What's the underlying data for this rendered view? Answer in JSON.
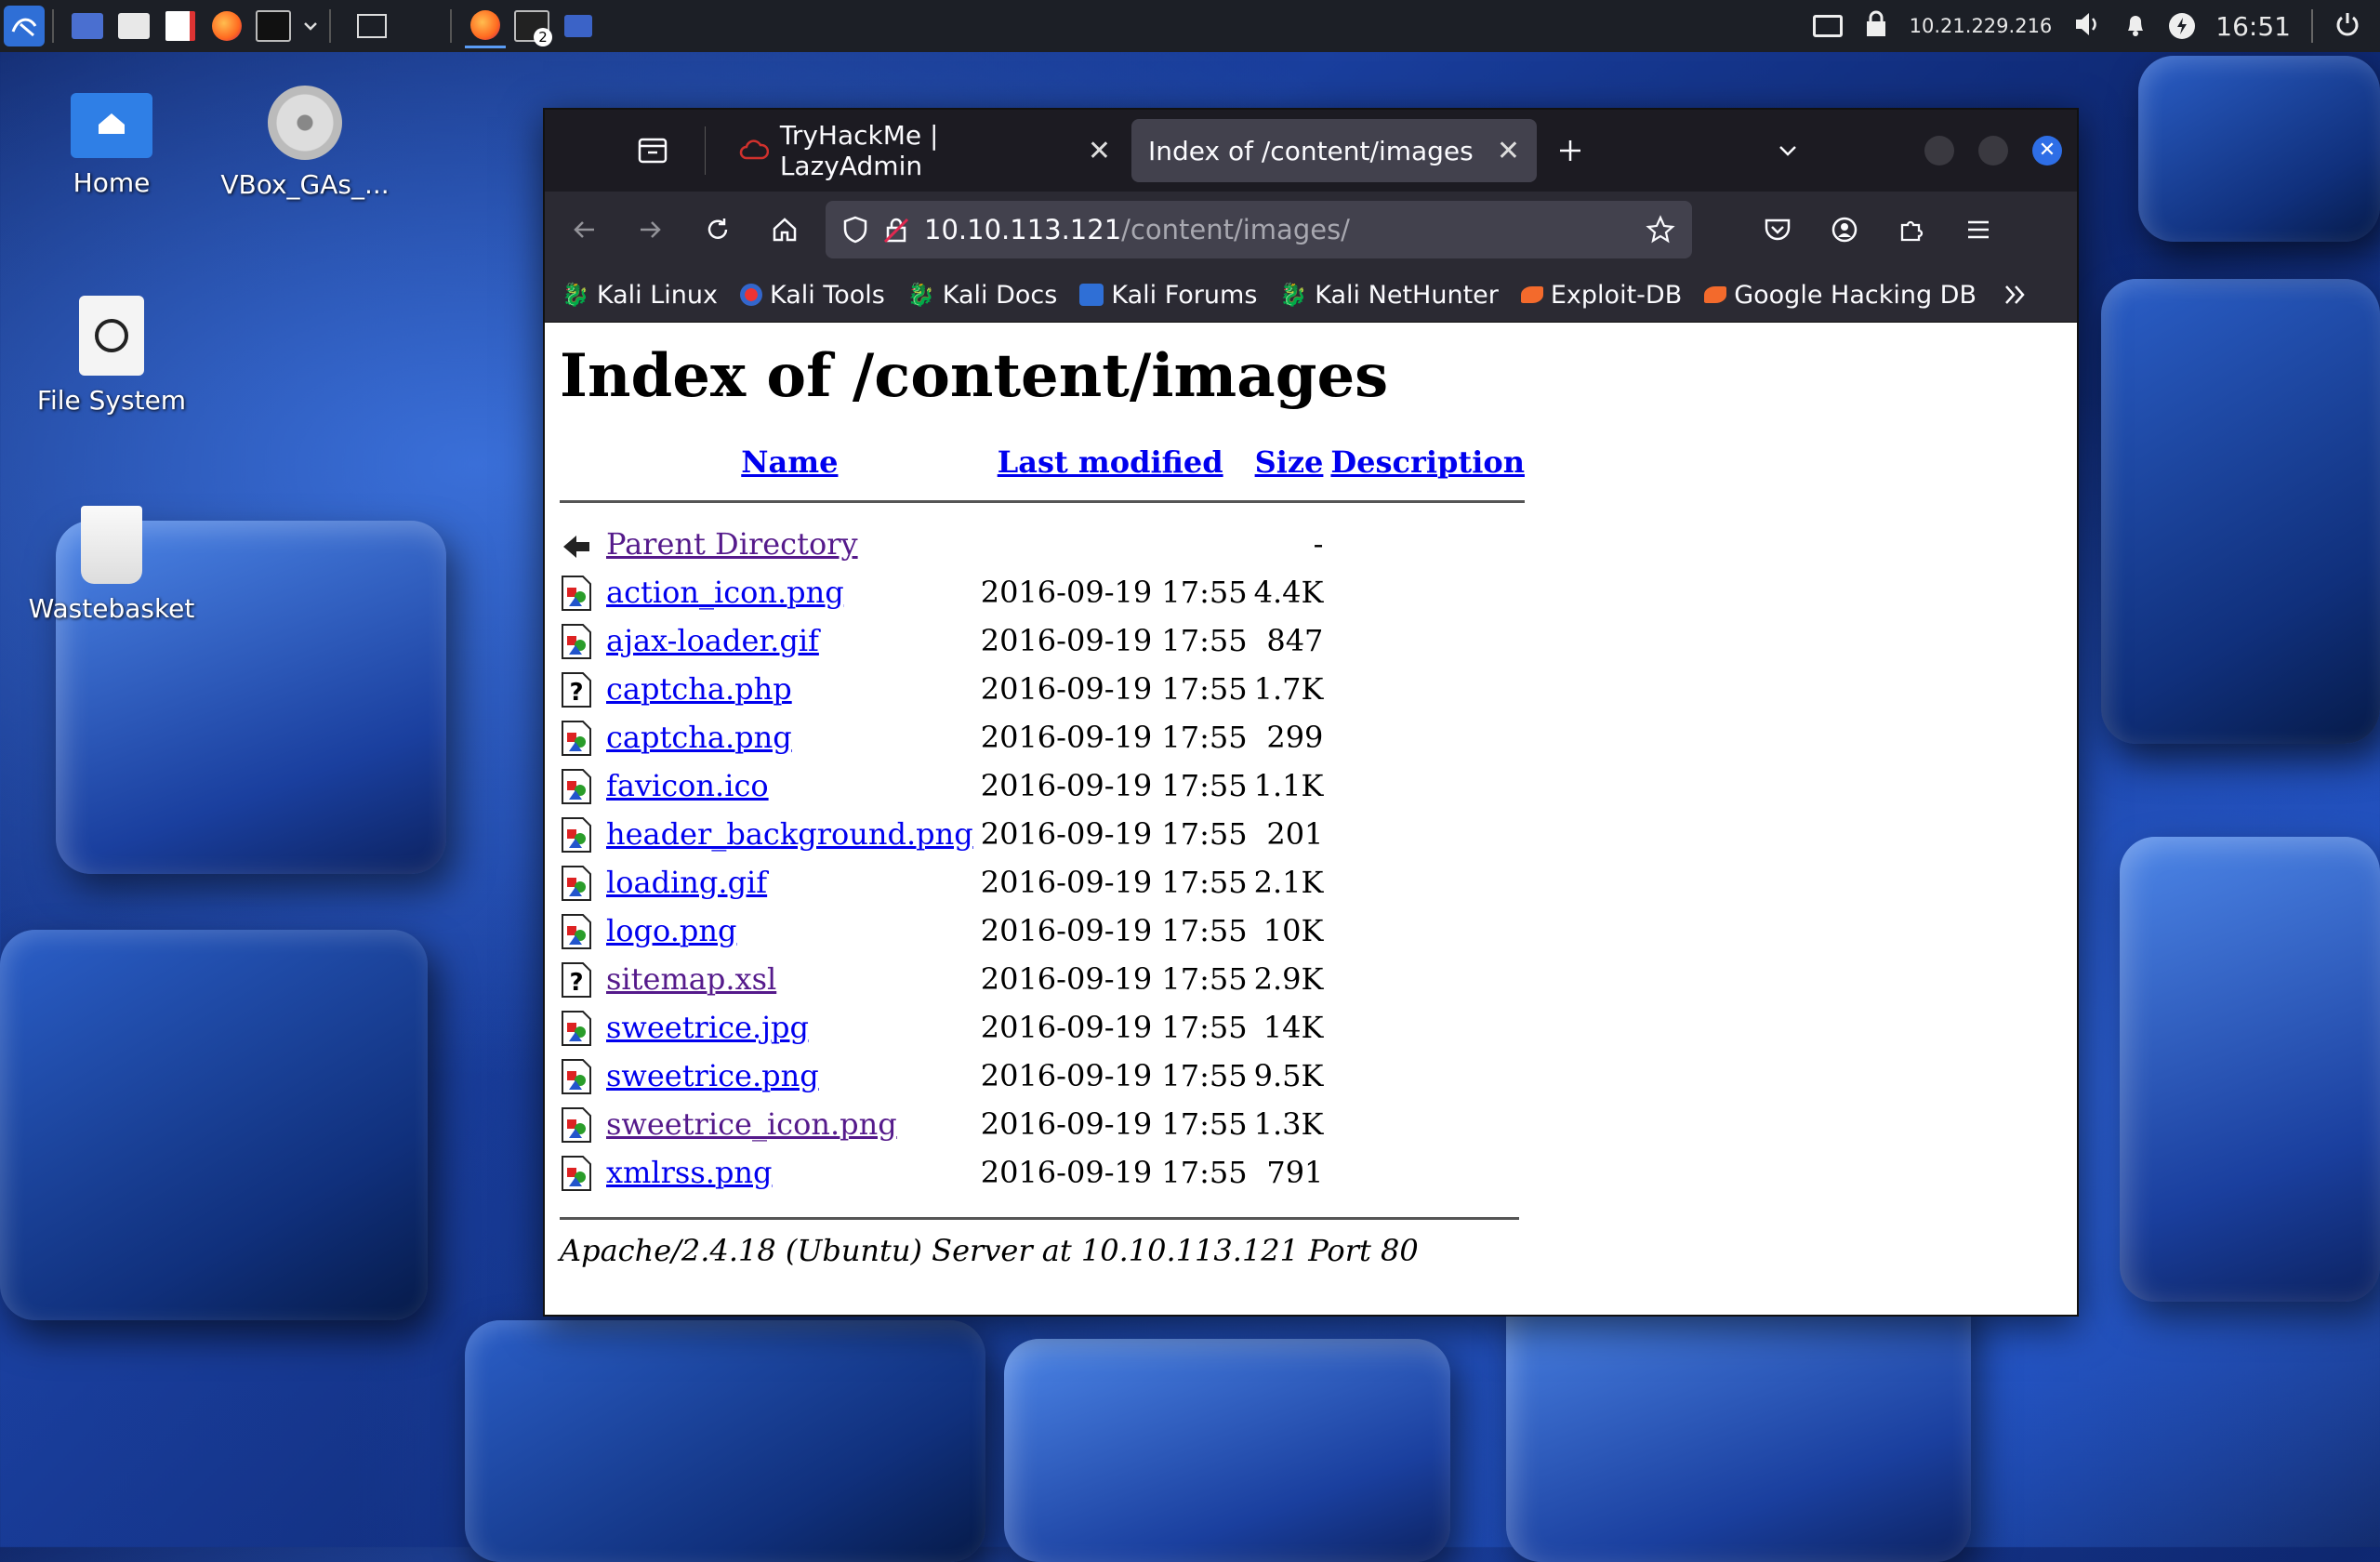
{
  "taskbar": {
    "ip": "10.21.229.216",
    "clock": "16:51",
    "terminal_badge": "2"
  },
  "desktop": {
    "icons": [
      {
        "label": "Home"
      },
      {
        "label": "VBox_GAs_..."
      },
      {
        "label": "File System"
      },
      {
        "label": "Wastebasket"
      }
    ]
  },
  "browser": {
    "tabs": [
      {
        "label": "TryHackMe | LazyAdmin"
      },
      {
        "label": "Index of /content/images"
      }
    ],
    "url_host": "10.10.113.121",
    "url_path": "/content/images/",
    "bookmarks": [
      "Kali Linux",
      "Kali Tools",
      "Kali Docs",
      "Kali Forums",
      "Kali NetHunter",
      "Exploit-DB",
      "Google Hacking DB"
    ]
  },
  "page": {
    "heading": "Index of /content/images",
    "columns": {
      "name": "Name",
      "modified": "Last modified",
      "size": "Size",
      "description": "Description"
    },
    "parent": {
      "name": "Parent Directory",
      "size": "-"
    },
    "rows": [
      {
        "name": "action_icon.png",
        "modified": "2016-09-19 17:55",
        "size": "4.4K",
        "type": "image"
      },
      {
        "name": "ajax-loader.gif",
        "modified": "2016-09-19 17:55",
        "size": "847",
        "type": "image"
      },
      {
        "name": "captcha.php",
        "modified": "2016-09-19 17:55",
        "size": "1.7K",
        "type": "unknown"
      },
      {
        "name": "captcha.png",
        "modified": "2016-09-19 17:55",
        "size": "299",
        "type": "image"
      },
      {
        "name": "favicon.ico",
        "modified": "2016-09-19 17:55",
        "size": "1.1K",
        "type": "image"
      },
      {
        "name": "header_background.png",
        "modified": "2016-09-19 17:55",
        "size": "201",
        "type": "image"
      },
      {
        "name": "loading.gif",
        "modified": "2016-09-19 17:55",
        "size": "2.1K",
        "type": "image"
      },
      {
        "name": "logo.png",
        "modified": "2016-09-19 17:55",
        "size": "10K",
        "type": "image"
      },
      {
        "name": "sitemap.xsl",
        "modified": "2016-09-19 17:55",
        "size": "2.9K",
        "type": "unknown",
        "visited": true
      },
      {
        "name": "sweetrice.jpg",
        "modified": "2016-09-19 17:55",
        "size": "14K",
        "type": "image"
      },
      {
        "name": "sweetrice.png",
        "modified": "2016-09-19 17:55",
        "size": "9.5K",
        "type": "image"
      },
      {
        "name": "sweetrice_icon.png",
        "modified": "2016-09-19 17:55",
        "size": "1.3K",
        "type": "image",
        "visited": true
      },
      {
        "name": "xmlrss.png",
        "modified": "2016-09-19 17:55",
        "size": "791",
        "type": "image"
      }
    ],
    "address": "Apache/2.4.18 (Ubuntu) Server at 10.10.113.121 Port 80"
  }
}
